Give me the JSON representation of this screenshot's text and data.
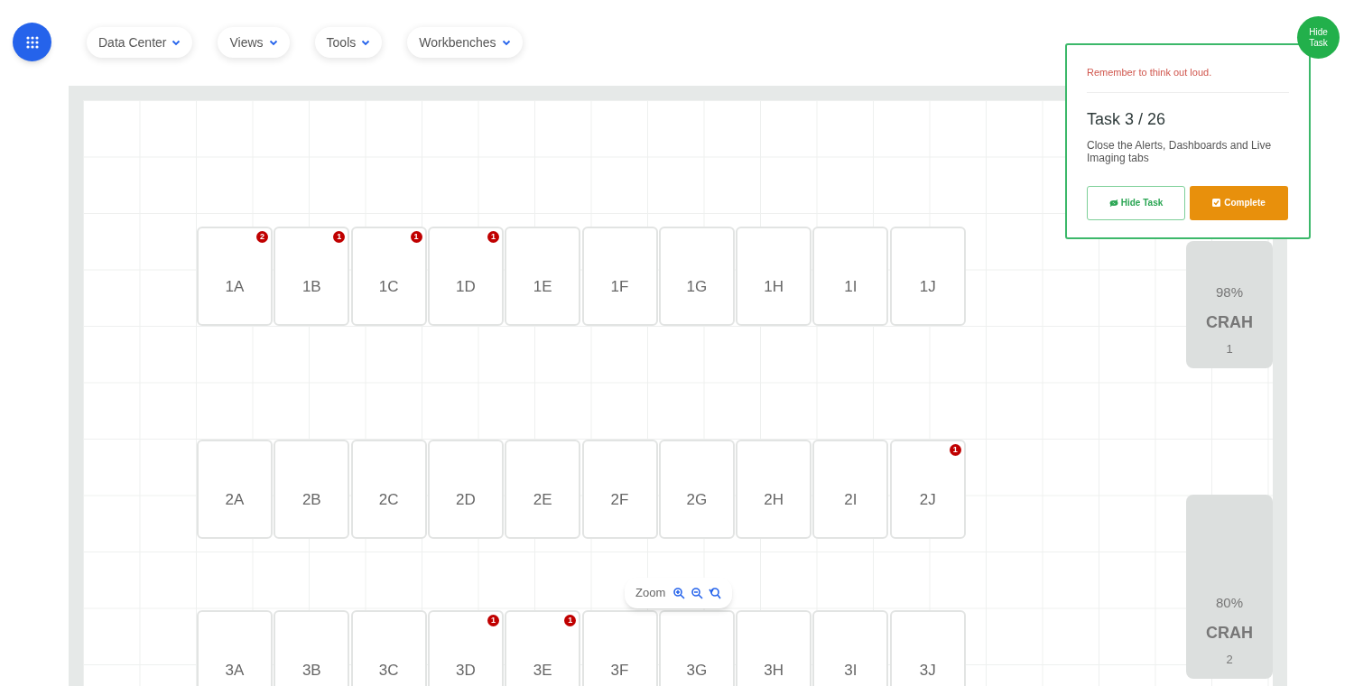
{
  "menus": [
    {
      "label": "Data Center"
    },
    {
      "label": "Views"
    },
    {
      "label": "Tools"
    },
    {
      "label": "Workbenches"
    }
  ],
  "rack_rows": [
    {
      "racks": [
        {
          "label": "1A",
          "alerts": "2"
        },
        {
          "label": "1B",
          "alerts": "1"
        },
        {
          "label": "1C",
          "alerts": "1"
        },
        {
          "label": "1D",
          "alerts": "1"
        },
        {
          "label": "1E"
        },
        {
          "label": "1F"
        },
        {
          "label": "1G"
        },
        {
          "label": "1H"
        },
        {
          "label": "1I"
        },
        {
          "label": "1J"
        }
      ]
    },
    {
      "racks": [
        {
          "label": "2A"
        },
        {
          "label": "2B"
        },
        {
          "label": "2C"
        },
        {
          "label": "2D"
        },
        {
          "label": "2E"
        },
        {
          "label": "2F"
        },
        {
          "label": "2G"
        },
        {
          "label": "2H"
        },
        {
          "label": "2I"
        },
        {
          "label": "2J",
          "alerts": "1"
        }
      ]
    },
    {
      "racks": [
        {
          "label": "3A"
        },
        {
          "label": "3B"
        },
        {
          "label": "3C"
        },
        {
          "label": "3D",
          "alerts": "1"
        },
        {
          "label": "3E",
          "alerts": "1"
        },
        {
          "label": "3F"
        },
        {
          "label": "3G"
        },
        {
          "label": "3H"
        },
        {
          "label": "3I"
        },
        {
          "label": "3J"
        }
      ]
    }
  ],
  "crah_units": [
    {
      "percent": "98%",
      "name": "CRAH",
      "number": "1"
    },
    {
      "percent": "80%",
      "name": "CRAH",
      "number": "2"
    }
  ],
  "zoom": {
    "label": "Zoom"
  },
  "task_panel": {
    "reminder": "Remember to think out loud.",
    "title": "Task 3 / 26",
    "description": "Close the Alerts, Dashboards and Live Imaging tabs",
    "hide_button": "Hide Task",
    "complete_button": "Complete"
  },
  "hide_task_bubble": "Hide Task"
}
